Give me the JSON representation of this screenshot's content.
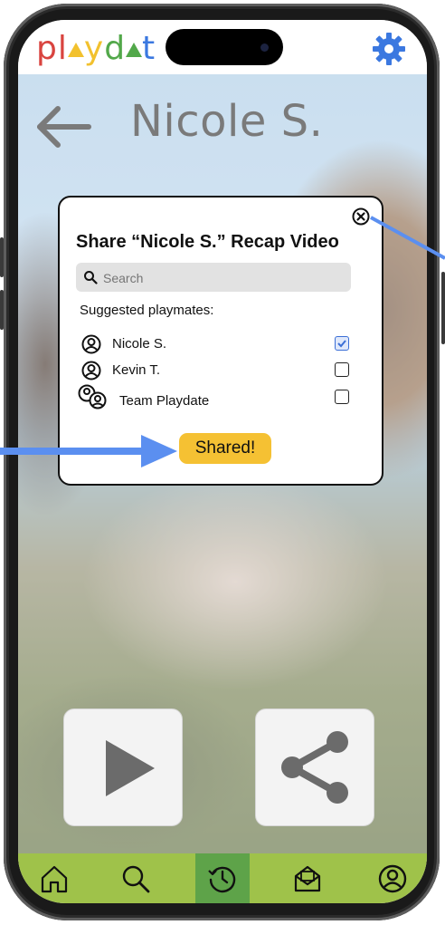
{
  "header": {
    "logo_letters": [
      "p",
      "l",
      "y",
      "d",
      "a",
      "t"
    ],
    "settings_icon": "gear-icon",
    "colors": {
      "gear": "#3b78e0",
      "logo_red": "#d9443f",
      "logo_yellow": "#f2c12e",
      "logo_green": "#52a84a",
      "logo_blue": "#3b78e0"
    }
  },
  "page": {
    "title": "Nicole S.",
    "back_icon": "arrow-left-icon"
  },
  "share_modal": {
    "title": "Share “Nicole S.” Recap Video",
    "search_placeholder": "Search",
    "suggested_label": "Suggested playmates:",
    "playmates": [
      {
        "name": "Nicole S.",
        "checked": true
      },
      {
        "name": "Kevin T.",
        "checked": false
      },
      {
        "name": "Team Playdate",
        "checked": false
      }
    ],
    "status_label": "Shared!",
    "close_icon": "close-circle-icon"
  },
  "actions": {
    "play_icon": "play-icon",
    "share_icon": "share-icon"
  },
  "bottom_nav": {
    "items": [
      "home-icon",
      "search-icon",
      "history-icon",
      "mail-icon",
      "profile-icon"
    ],
    "active": "history-icon",
    "colors": {
      "bar": "#9fc24a",
      "active": "#5ea349"
    }
  },
  "annotation_color": "#5b8ff0"
}
